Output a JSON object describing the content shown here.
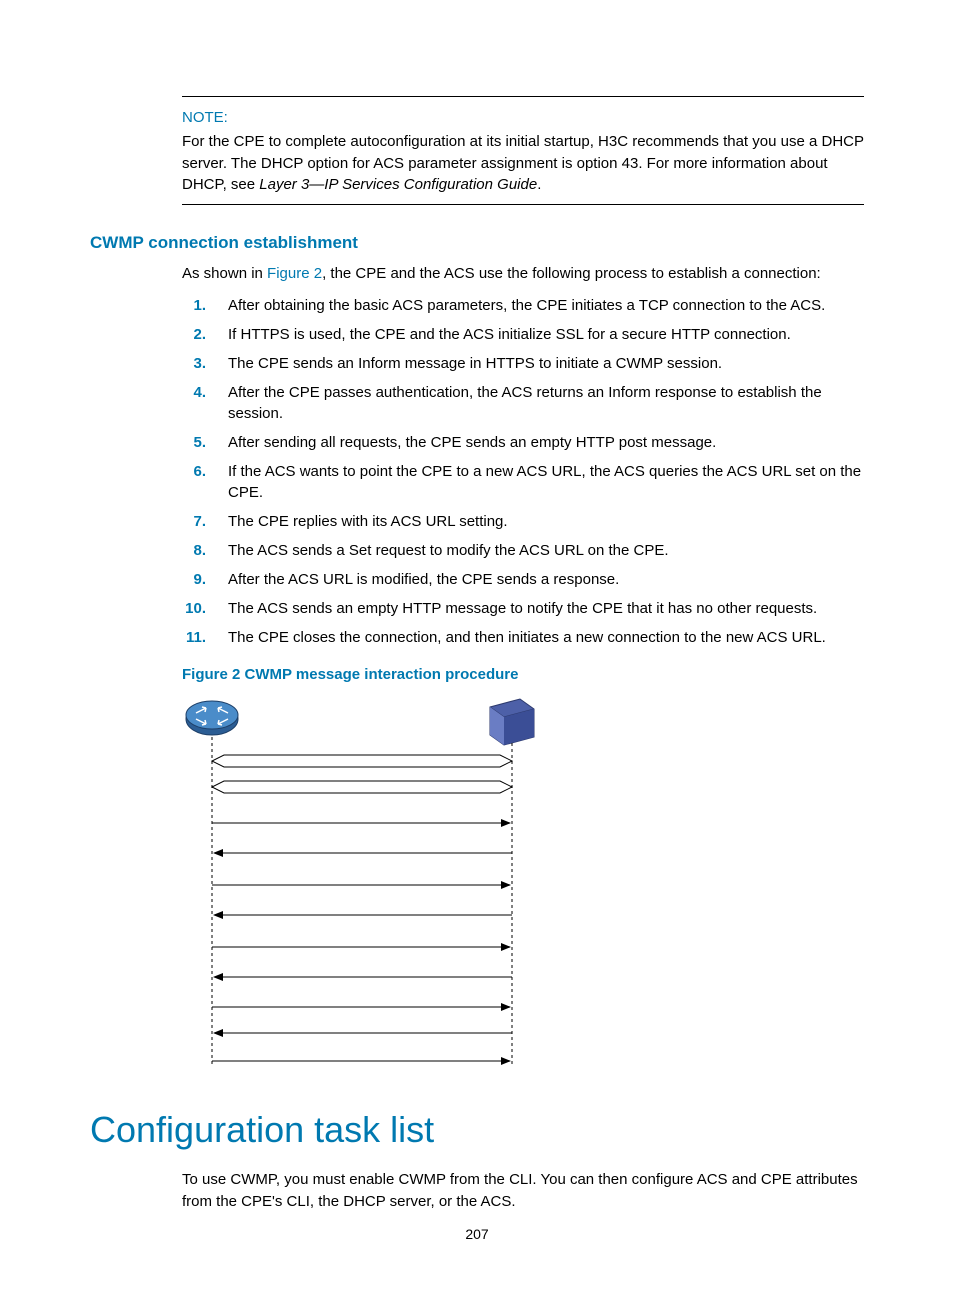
{
  "note": {
    "label": "NOTE:",
    "text_before_ref": "For the CPE to complete autoconfiguration at its initial startup, H3C recommends that you use a DHCP server. The DHCP option for ACS parameter assignment is option 43. For more information about DHCP, see ",
    "ref": "Layer 3—IP Services Configuration Guide",
    "text_after_ref": "."
  },
  "section_h3": "CWMP connection establishment",
  "intro": {
    "before": "As shown in ",
    "link": "Figure 2",
    "after": ", the CPE and the ACS use the following process to establish a connection:"
  },
  "steps": [
    "After obtaining the basic ACS parameters, the CPE initiates a TCP connection to the ACS.",
    "If HTTPS is used, the CPE and the ACS initialize SSL for a secure HTTP connection.",
    "The CPE sends an Inform message in HTTPS to initiate a CWMP session.",
    "After the CPE passes authentication, the ACS returns an Inform response to establish the session.",
    "After sending all requests, the CPE sends an empty HTTP post message.",
    "If the ACS wants to point the CPE to a new ACS URL, the ACS queries the ACS URL set on the CPE.",
    "The CPE replies with its ACS URL setting.",
    "The ACS sends a Set request to modify the ACS URL on the CPE.",
    "After the ACS URL is modified, the CPE sends a response.",
    "The ACS sends an empty HTTP message to notify the CPE that it has no other requests.",
    "The CPE closes the connection, and then initiates a new connection to the new ACS URL."
  ],
  "figure_caption": "Figure 2 CWMP message interaction procedure",
  "h1": "Configuration task list",
  "h1_body": "To use CWMP, you must enable CWMP from the CLI. You can then configure ACS and CPE attributes from the CPE's CLI, the DHCP server, or the ACS.",
  "page_number": "207"
}
